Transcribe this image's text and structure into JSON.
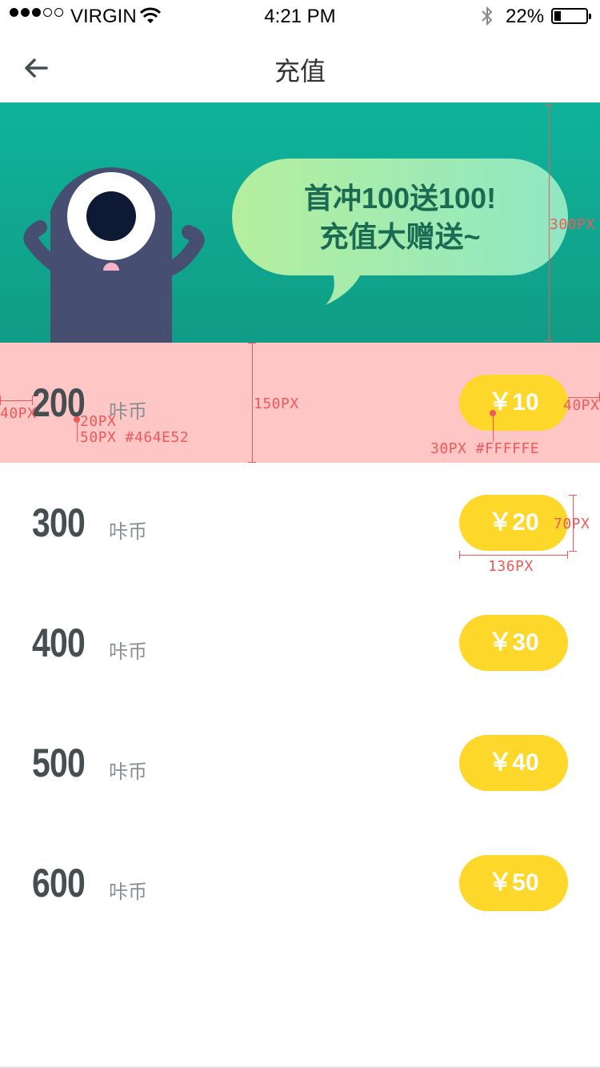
{
  "status_bar": {
    "carrier": "VIRGIN",
    "time": "4:21 PM",
    "battery": "22%",
    "battery_level": 0.22
  },
  "nav": {
    "title": "充值",
    "back_icon": "arrow-left-icon"
  },
  "banner": {
    "line1": "首冲100送100!",
    "line2": "充值大赠送~",
    "colors": {
      "background": "#0fb39a",
      "monster": "#464e72",
      "bubble": "#b5ef9e"
    }
  },
  "packages": [
    {
      "amount": "200",
      "unit": "咔币",
      "price": "￥10"
    },
    {
      "amount": "300",
      "unit": "咔币",
      "price": "￥20"
    },
    {
      "amount": "400",
      "unit": "咔币",
      "price": "￥30"
    },
    {
      "amount": "500",
      "unit": "咔币",
      "price": "￥40"
    },
    {
      "amount": "600",
      "unit": "咔币",
      "price": "￥50"
    }
  ],
  "annotations": {
    "banner_height": "300PX",
    "left_margin": "40PX",
    "unit_gap": "20PX",
    "amount_style": "50PX #464E52",
    "row_height": "150PX",
    "price_style": "30PX #FFFFFE",
    "right_margin": "40PX",
    "button_height": "70PX",
    "button_width": "136PX"
  },
  "colors": {
    "accent": "#fdd82b",
    "text_primary": "#464e52",
    "highlight_row": "#ffc6c6",
    "annotation": "#ee5a5a"
  }
}
